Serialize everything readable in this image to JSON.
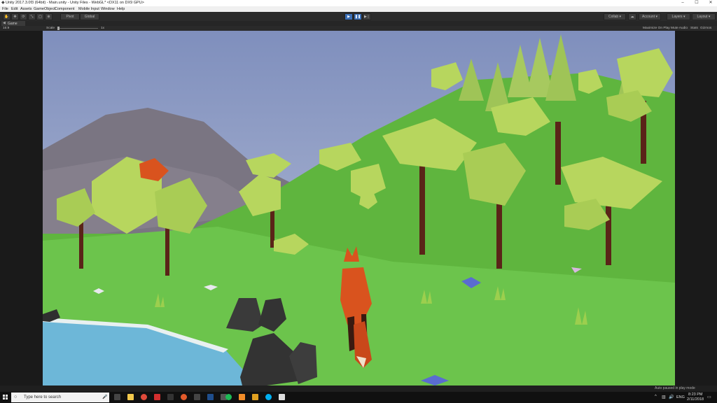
{
  "window": {
    "title": "Unity 2017.3.0f3 (64bit) - Main.unity - Unity Files - WebGL* <DX11 on DX9 GPU>",
    "minimize": "–",
    "maximize": "☐",
    "close": "✕"
  },
  "menu": [
    "File",
    "Edit",
    "Assets",
    "GameObject",
    "Component",
    "Mobile Input",
    "Window",
    "Help"
  ],
  "toolbar": {
    "pivot_label": "Pivot",
    "global_label": "Global",
    "play": "▶",
    "pause": "❚❚",
    "step": "▶❘",
    "collab": "Collab ▾",
    "account": "Account ▾",
    "layers": "Layers ▾",
    "layout": "Layout ▾"
  },
  "tabs": {
    "game": "Game"
  },
  "game_bar": {
    "display": "16:9",
    "scale_label": "Scale",
    "scale_value": "1x",
    "maximize_on_play": "Maximize On Play",
    "mute_audio": "Mute Audio",
    "stats": "Stats",
    "gizmos": "Gizmos"
  },
  "status": {
    "message": "Auto paused in play mode"
  },
  "taskbar": {
    "search_placeholder": "Type here to search",
    "language": "ENG",
    "time": "8:23 PM",
    "date": "2/11/2018"
  },
  "colors": {
    "sky": "#8fa0c8",
    "grass": "#64c048",
    "foliage": "#b7d65e",
    "trunk": "#5a2418",
    "fox": "#d9531e",
    "water": "#6db7d8",
    "rock": "#3a3a3a"
  }
}
